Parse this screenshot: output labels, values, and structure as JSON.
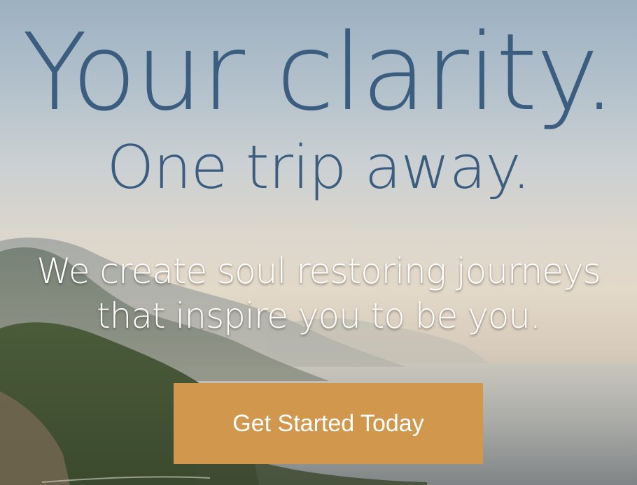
{
  "hero": {
    "headline_line1": "Your clarity.",
    "headline_line2": "One trip away.",
    "tagline_line1": "We create soul restoring journeys",
    "tagline_line2": "that inspire you to be you.",
    "cta_label": "Get Started Today"
  },
  "colors": {
    "headline": "#3a5d80",
    "tagline": "#ffffff",
    "cta_background": "#d0974d",
    "cta_text": "#ffffff"
  }
}
